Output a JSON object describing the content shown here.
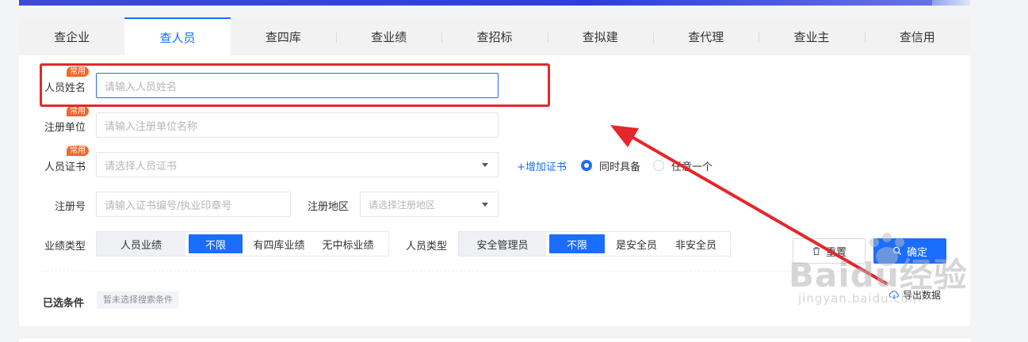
{
  "tabs": [
    {
      "label": "查企业",
      "active": false
    },
    {
      "label": "查人员",
      "active": true
    },
    {
      "label": "查四库",
      "active": false
    },
    {
      "label": "查业绩",
      "active": false
    },
    {
      "label": "查招标",
      "active": false
    },
    {
      "label": "查拟建",
      "active": false
    },
    {
      "label": "查代理",
      "active": false
    },
    {
      "label": "查业主",
      "active": false
    },
    {
      "label": "查信用",
      "active": false
    }
  ],
  "form": {
    "badge_common": "常用",
    "name": {
      "label": "人员姓名",
      "placeholder": "请输入人员姓名",
      "value": ""
    },
    "company": {
      "label": "注册单位",
      "placeholder": "请输入注册单位名称",
      "value": ""
    },
    "cert": {
      "label": "人员证书",
      "placeholder": "请选择人员证书",
      "add_link": "+增加证书"
    },
    "cert_mode": {
      "option_all": "同时具备",
      "option_any": "任意一个",
      "selected": "同时具备"
    },
    "reg_no": {
      "label": "注册号",
      "placeholder": "请输入证书编号/执业印章号"
    },
    "reg_area": {
      "label": "注册地区",
      "placeholder": "请选择注册地区"
    },
    "perf_type": {
      "label": "业绩类型",
      "segment_title": "人员业绩",
      "options": [
        "不限",
        "有四库业绩",
        "无中标业绩"
      ],
      "selected": "不限"
    },
    "person_type": {
      "label": "人员类型",
      "segment_title": "安全管理员",
      "options": [
        "不限",
        "是安全员",
        "非安全员"
      ],
      "selected": "不限"
    }
  },
  "actions": {
    "reset": "重置",
    "confirm": "确定",
    "export": "导出数据"
  },
  "selected_conditions": {
    "label": "已选条件",
    "empty_text": "暂未选择搜索条件"
  },
  "watermark": {
    "brand": "Baidu经验",
    "url": "jingyan.baidu.com"
  },
  "colors": {
    "accent": "#1a6dff",
    "badge": "#f2672a",
    "annotation": "#e5262a"
  }
}
